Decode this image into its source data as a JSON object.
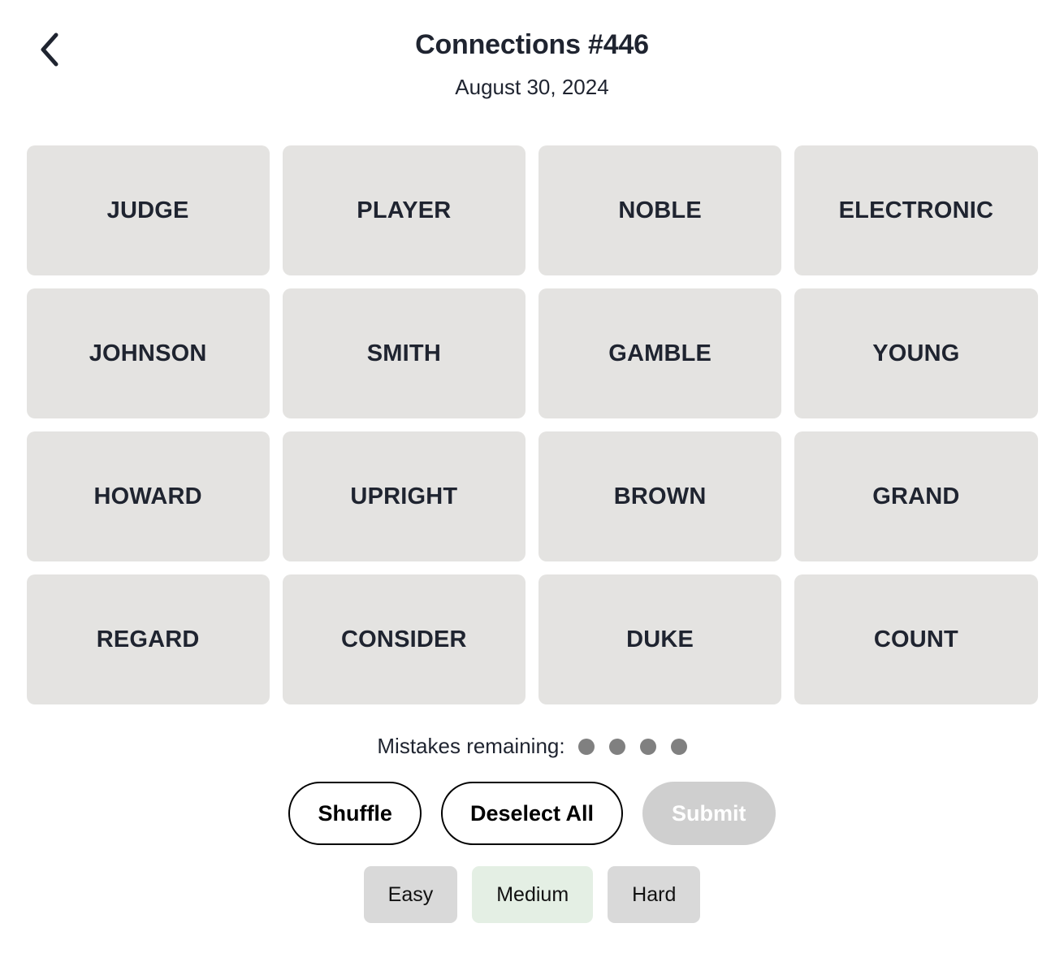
{
  "header": {
    "back_icon": "chevron-left-icon",
    "title": "Connections #446",
    "date": "August 30, 2024"
  },
  "board": {
    "tiles": [
      "JUDGE",
      "PLAYER",
      "NOBLE",
      "ELECTRONIC",
      "JOHNSON",
      "SMITH",
      "GAMBLE",
      "YOUNG",
      "HOWARD",
      "UPRIGHT",
      "BROWN",
      "GRAND",
      "REGARD",
      "CONSIDER",
      "DUKE",
      "COUNT"
    ],
    "tile_bg": "#e4e3e1",
    "tile_text_color": "#1f2430"
  },
  "mistakes": {
    "label": "Mistakes remaining:",
    "remaining": 4,
    "dot_color": "#808080"
  },
  "actions": {
    "shuffle_label": "Shuffle",
    "deselect_label": "Deselect All",
    "submit_label": "Submit",
    "submit_disabled": true,
    "disabled_bg": "#cfcfcf"
  },
  "difficulty": {
    "options": [
      "Easy",
      "Medium",
      "Hard"
    ],
    "selected": "Medium",
    "selected_bg": "#e4efe4",
    "unselected_bg": "#d9d9d9"
  }
}
